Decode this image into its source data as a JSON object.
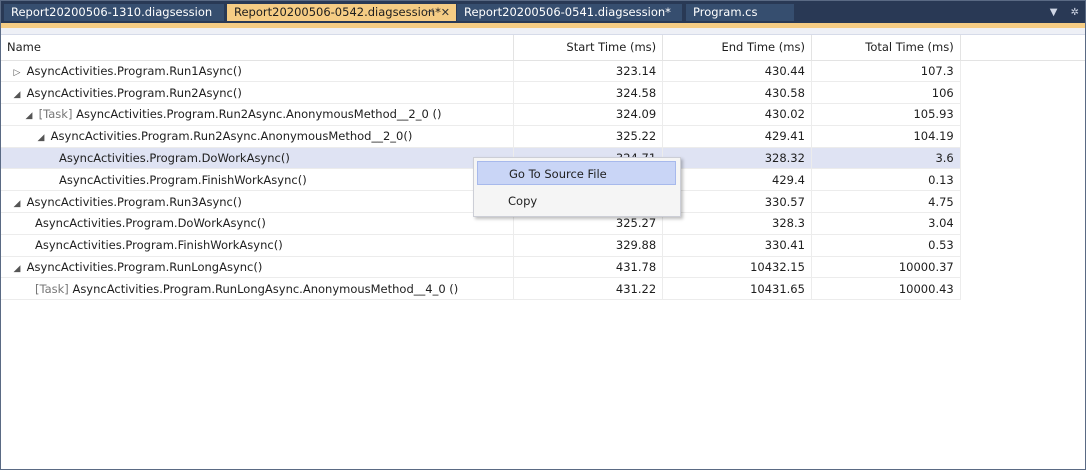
{
  "tabs": [
    {
      "label": "Report20200506-1310.diagsession",
      "active": false
    },
    {
      "label": "Report20200506-0542.diagsession*",
      "active": true
    },
    {
      "label": "Report20200506-0541.diagsession*",
      "active": false
    },
    {
      "label": "Program.cs",
      "active": false
    }
  ],
  "tab_glyphs": {
    "pin": "⊣",
    "close": "✕",
    "overflow": "▼",
    "settings": "✲"
  },
  "columns": {
    "name": "Name",
    "start": "Start Time (ms)",
    "end": "End Time (ms)",
    "total": "Total Time (ms)"
  },
  "expander_glyphs": {
    "collapsed": "▷",
    "expanded": "◢"
  },
  "rows": [
    {
      "expander": "collapsed",
      "level": 0,
      "prefix": "",
      "name": "AsyncActivities.Program.Run1Async()",
      "start": "323.14",
      "end": "430.44",
      "total": "107.3"
    },
    {
      "expander": "expanded",
      "level": 0,
      "prefix": "",
      "name": "AsyncActivities.Program.Run2Async()",
      "start": "324.58",
      "end": "430.58",
      "total": "106"
    },
    {
      "expander": "expanded",
      "level": 1,
      "prefix": "[Task]",
      "name": "AsyncActivities.Program.Run2Async.AnonymousMethod__2_0 ()",
      "start": "324.09",
      "end": "430.02",
      "total": "105.93"
    },
    {
      "expander": "expanded",
      "level": 2,
      "prefix": "",
      "name": "AsyncActivities.Program.Run2Async.AnonymousMethod__2_0()",
      "start": "325.22",
      "end": "429.41",
      "total": "104.19"
    },
    {
      "expander": "none",
      "level": 3,
      "prefix": "",
      "name": "AsyncActivities.Program.DoWorkAsync()",
      "start": "324.71",
      "end": "328.32",
      "total": "3.6",
      "selected": true
    },
    {
      "expander": "none",
      "level": 3,
      "prefix": "",
      "name": "AsyncActivities.Program.FinishWorkAsync()",
      "start": "",
      "end": "429.4",
      "total": "0.13"
    },
    {
      "expander": "expanded",
      "level": 0,
      "prefix": "",
      "name": "AsyncActivities.Program.Run3Async()",
      "start": "",
      "end": "330.57",
      "total": "4.75"
    },
    {
      "expander": "none",
      "level": 1,
      "prefix": "",
      "name": "AsyncActivities.Program.DoWorkAsync()",
      "start": "325.27",
      "end": "328.3",
      "total": "3.04"
    },
    {
      "expander": "none",
      "level": 1,
      "prefix": "",
      "name": "AsyncActivities.Program.FinishWorkAsync()",
      "start": "329.88",
      "end": "330.41",
      "total": "0.53"
    },
    {
      "expander": "expanded",
      "level": 0,
      "prefix": "",
      "name": "AsyncActivities.Program.RunLongAsync()",
      "start": "431.78",
      "end": "10432.15",
      "total": "10000.37"
    },
    {
      "expander": "none",
      "level": 1,
      "prefix": "[Task]",
      "name": "AsyncActivities.Program.RunLongAsync.AnonymousMethod__4_0 ()",
      "start": "431.22",
      "end": "10431.65",
      "total": "10000.43"
    }
  ],
  "context_menu": {
    "items": [
      "Go To Source File",
      "Copy"
    ]
  },
  "colors": {
    "tabbar": "#293955",
    "active_tab": "#f5cc84",
    "inactive_tab": "#364e6f",
    "selected_row": "#dfe3f3",
    "menu_highlight": "#c9d5f6"
  }
}
